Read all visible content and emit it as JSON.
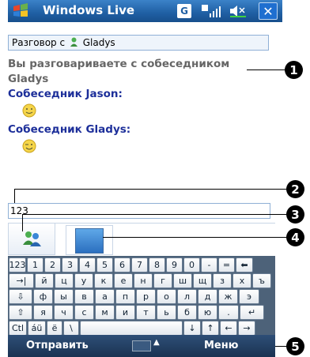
{
  "titlebar": {
    "app_title": "Windows Live",
    "g_label": "G",
    "close_label": "✕"
  },
  "conversation": {
    "prefix": "Разговор с",
    "contact": "Gladys"
  },
  "chat": {
    "status_message": "Вы разговариваете с собеседником Gladys",
    "messages": [
      {
        "speaker": "Собеседник Jason:"
      },
      {
        "speaker": "Собеседник Gladys:"
      }
    ]
  },
  "input": {
    "value": "123"
  },
  "callouts": [
    "1",
    "2",
    "3",
    "4",
    "5"
  ],
  "keyboard": {
    "rows": [
      [
        "123",
        "1",
        "2",
        "3",
        "4",
        "5",
        "6",
        "7",
        "8",
        "9",
        "0",
        "-",
        "=",
        "⬅"
      ],
      [
        "→|",
        "й",
        "ц",
        "у",
        "к",
        "е",
        "н",
        "г",
        "ш",
        "щ",
        "з",
        "х",
        "ъ"
      ],
      [
        "⇩",
        "ф",
        "ы",
        "в",
        "а",
        "п",
        "р",
        "о",
        "л",
        "д",
        "ж",
        "э"
      ],
      [
        "⇧",
        "я",
        "ч",
        "с",
        "м",
        "и",
        "т",
        "ь",
        "б",
        "ю",
        ".",
        "↵"
      ],
      [
        "Ctl",
        "áü",
        "ё",
        "\\",
        " ",
        "↓",
        "↑",
        "←",
        "→"
      ]
    ]
  },
  "softkeys": {
    "left": "Отправить",
    "right": "Меню"
  },
  "colors": {
    "titlebar": "#1f5fa3",
    "speaker": "#1d2f9a",
    "keyboard_bg": "#4d6279"
  }
}
